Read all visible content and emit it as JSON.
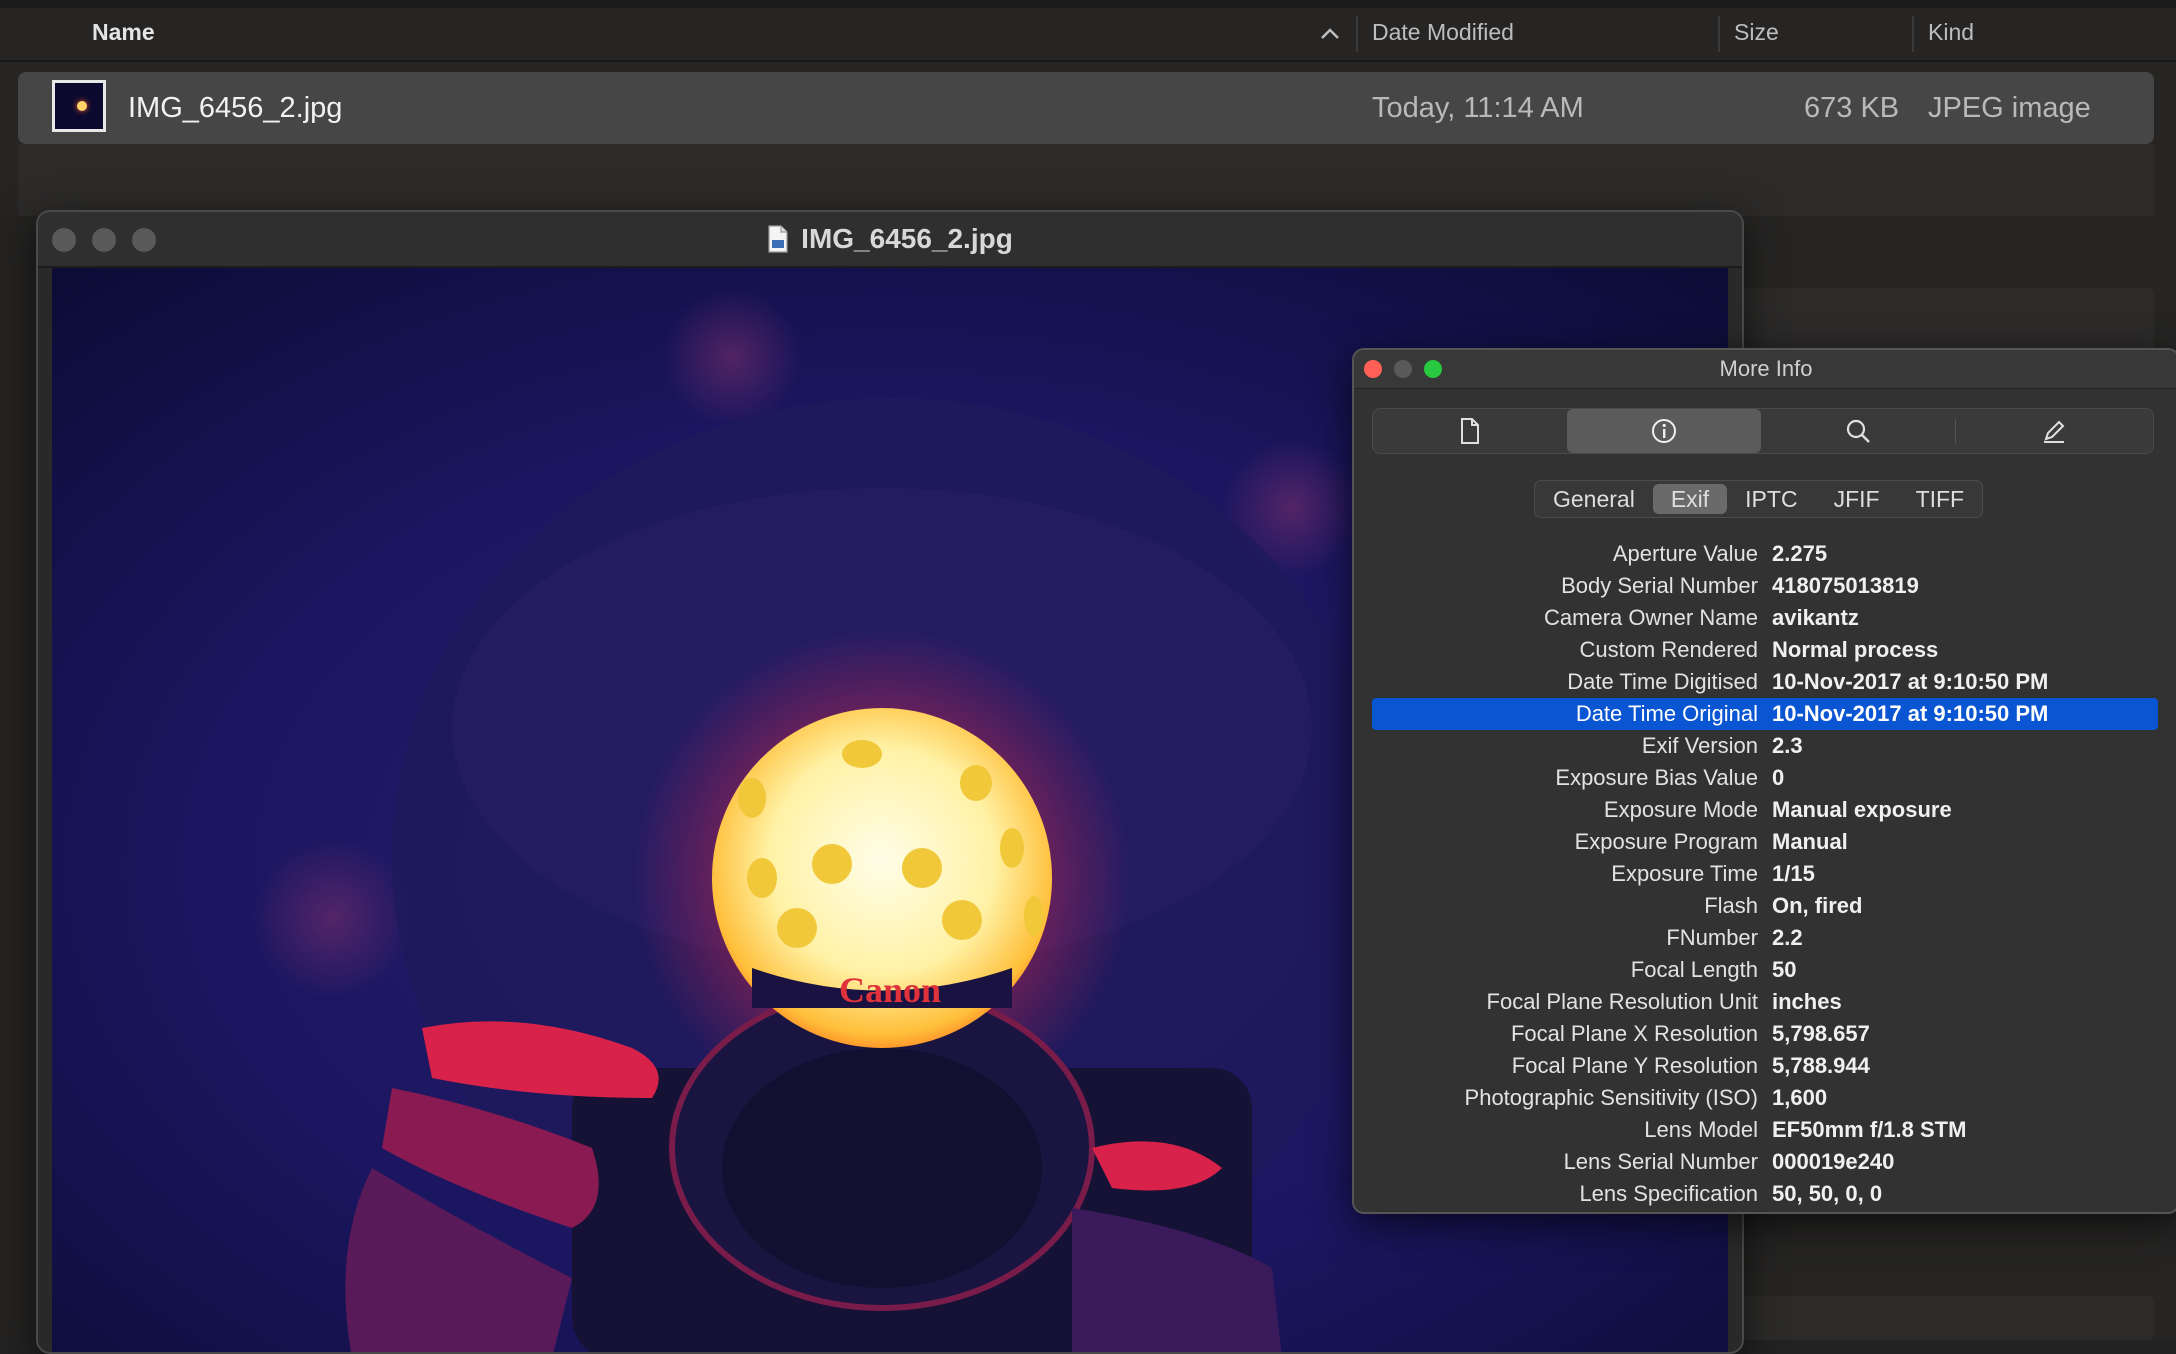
{
  "finder": {
    "columns": {
      "name": "Name",
      "date_modified": "Date Modified",
      "size": "Size",
      "kind": "Kind"
    },
    "file": {
      "name": "IMG_6456_2.jpg",
      "date_modified": "Today, 11:14 AM",
      "size": "673 KB",
      "kind": "JPEG image"
    }
  },
  "preview": {
    "title": "IMG_6456_2.jpg",
    "photo_brand_text": "Canon"
  },
  "info": {
    "title": "More Info",
    "toolbar": [
      "document-icon",
      "info-icon",
      "search-icon",
      "pencil-icon"
    ],
    "tabs": [
      "General",
      "Exif",
      "IPTC",
      "JFIF",
      "TIFF"
    ],
    "active_tab": "Exif",
    "rows": [
      {
        "key": "Aperture Value",
        "value": "2.275"
      },
      {
        "key": "Body Serial Number",
        "value": "418075013819"
      },
      {
        "key": "Camera Owner Name",
        "value": "avikantz"
      },
      {
        "key": "Custom Rendered",
        "value": "Normal process"
      },
      {
        "key": "Date Time Digitised",
        "value": "10-Nov-2017 at 9:10:50 PM"
      },
      {
        "key": "Date Time Original",
        "value": "10-Nov-2017 at 9:10:50 PM"
      },
      {
        "key": "Exif Version",
        "value": "2.3"
      },
      {
        "key": "Exposure Bias Value",
        "value": "0"
      },
      {
        "key": "Exposure Mode",
        "value": "Manual exposure"
      },
      {
        "key": "Exposure Program",
        "value": "Manual"
      },
      {
        "key": "Exposure Time",
        "value": "1/15"
      },
      {
        "key": "Flash",
        "value": "On, fired"
      },
      {
        "key": "FNumber",
        "value": "2.2"
      },
      {
        "key": "Focal Length",
        "value": "50"
      },
      {
        "key": "Focal Plane Resolution Unit",
        "value": "inches"
      },
      {
        "key": "Focal Plane X Resolution",
        "value": "5,798.657"
      },
      {
        "key": "Focal Plane Y Resolution",
        "value": "5,788.944"
      },
      {
        "key": "Photographic Sensitivity (ISO)",
        "value": "1,600"
      },
      {
        "key": "Lens Model",
        "value": "EF50mm f/1.8 STM"
      },
      {
        "key": "Lens Serial Number",
        "value": "000019e240"
      },
      {
        "key": "Lens Specification",
        "value": "50, 50, 0, 0"
      }
    ],
    "selected_row": "Date Time Original"
  },
  "colors": {
    "selection": "#0a56d2",
    "close": "#ff5f57",
    "minimize": "#5a5959",
    "zoom": "#28c840"
  }
}
